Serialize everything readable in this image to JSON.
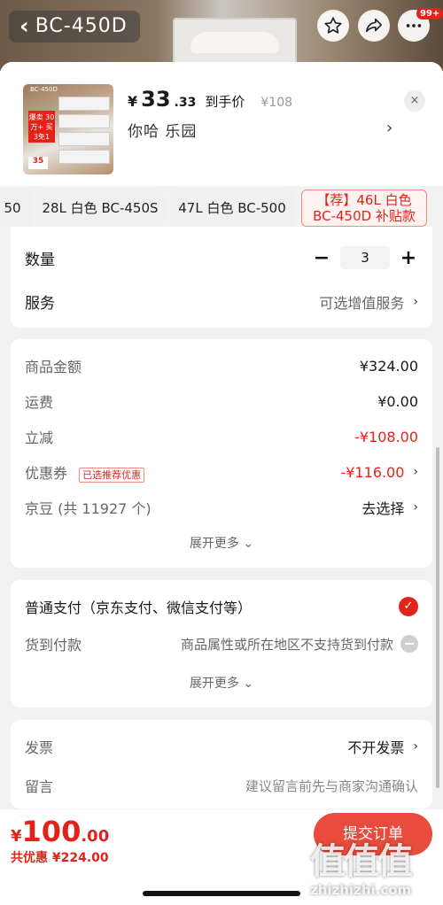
{
  "header": {
    "model_label": "BC-450D",
    "more_badge": "99+"
  },
  "product": {
    "thumb_model": "BC-450D",
    "thumb_tag": "爆卖 30万+ 买3免1",
    "thumb_price": "35",
    "price_yen": "¥",
    "price_int": "33",
    "price_dec": ".33",
    "price_label": "到手价",
    "original_price": "¥108",
    "shop_name": "你哈  乐园",
    "close": "×"
  },
  "specs": [
    {
      "label": "50"
    },
    {
      "label": "28L 白色 BC-450S"
    },
    {
      "label": "47L 白色 BC-500"
    },
    {
      "label": "【荐】46L 白色 BC-450D 补贴款"
    }
  ],
  "quantity": {
    "label": "数量",
    "minus": "−",
    "value": "3",
    "plus": "+"
  },
  "service": {
    "label": "服务",
    "value": "可选增值服务"
  },
  "summary": {
    "goods_amount_label": "商品金额",
    "goods_amount": "¥324.00",
    "shipping_label": "运费",
    "shipping": "¥0.00",
    "discount_label": "立减",
    "discount": "-¥108.00",
    "coupon_label": "优惠券",
    "coupon_tag": "已选推荐优惠",
    "coupon": "-¥116.00",
    "jingdou_label": "京豆 (共 11927 个)",
    "jingdou_action": "去选择",
    "expand": "展开更多 ⌄"
  },
  "payment": {
    "normal_label": "普通支付（京东支付、微信支付等）",
    "cod_label": "货到付款",
    "cod_note": "商品属性或所在地区不支持货到付款",
    "expand": "展开更多 ⌄"
  },
  "invoice": {
    "invoice_label": "发票",
    "invoice_value": "不开发票",
    "note_label": "留言",
    "note_placeholder": "建议留言前先与商家沟通确认"
  },
  "bottom": {
    "total_yen": "¥",
    "total_int": "100",
    "total_dec": ".00",
    "saving": "共优惠 ¥224.00",
    "submit": "提交订单"
  },
  "watermark": {
    "big": "值值值",
    "url": "zhizhizhi.com"
  },
  "colors": {
    "accent": "#e2231a",
    "button": "#e94b3c"
  }
}
